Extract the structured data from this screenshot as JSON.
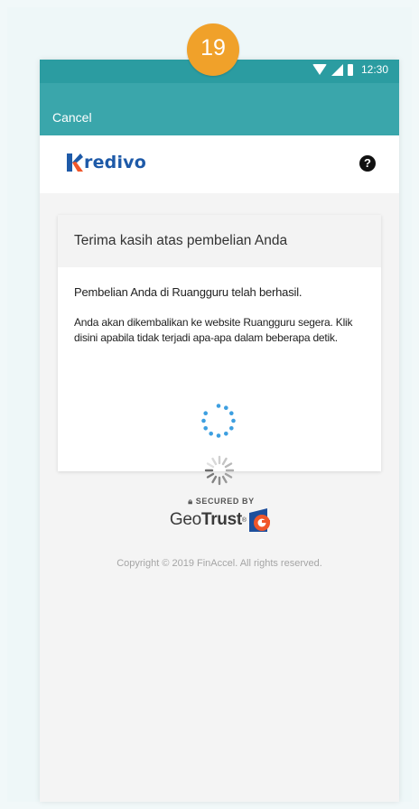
{
  "step_badge": "19",
  "status_bar": {
    "time": "12:30"
  },
  "app_bar": {
    "cancel_label": "Cancel"
  },
  "header": {
    "logo_text": "redivo",
    "help_icon": "question-icon"
  },
  "card": {
    "title": "Terima kasih atas pembelian Anda",
    "message": "Pembelian Anda di Ruangguru telah berhasil.",
    "redirect_note": "Anda akan dikembalikan ke website Ruangguru segera. Klik disini apabila tidak terjadi apa-apa dalam beberapa detik."
  },
  "security": {
    "label": "SECURED BY",
    "brand_light": "Geo",
    "brand_bold": "Trust",
    "registered": "®"
  },
  "footer": {
    "copyright": "Copyright © 2019 FinAccel. All rights reserved."
  },
  "colors": {
    "status_bar": "#2b9ca1",
    "app_bar": "#3aa6ab",
    "brand_blue": "#1e5aa8",
    "brand_orange": "#f0562a",
    "badge": "#f0a12a"
  }
}
